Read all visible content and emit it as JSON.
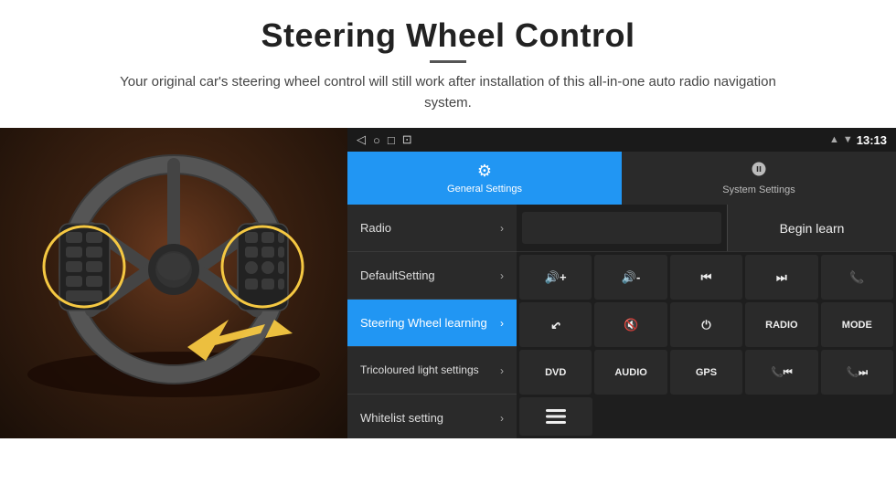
{
  "header": {
    "title": "Steering Wheel Control",
    "divider": true,
    "subtitle": "Your original car's steering wheel control will still work after installation of this all-in-one auto radio navigation system."
  },
  "statusBar": {
    "navBack": "◁",
    "navHome": "○",
    "navRecent": "□",
    "navCast": "⊡",
    "signal": "▾▴",
    "wifi": "▾",
    "time": "13:13"
  },
  "tabs": [
    {
      "id": "general",
      "label": "General Settings",
      "icon": "⚙",
      "active": true
    },
    {
      "id": "system",
      "label": "System Settings",
      "icon": "⚙",
      "active": false
    }
  ],
  "menu": [
    {
      "id": "radio",
      "label": "Radio",
      "active": false
    },
    {
      "id": "default",
      "label": "DefaultSetting",
      "active": false
    },
    {
      "id": "steering",
      "label": "Steering Wheel learning",
      "active": true
    },
    {
      "id": "tricoloured",
      "label": "Tricoloured light settings",
      "active": false
    },
    {
      "id": "whitelist",
      "label": "Whitelist setting",
      "active": false
    }
  ],
  "controls": {
    "beginLearnLabel": "Begin learn",
    "buttons": [
      {
        "id": "vol-up",
        "label": "◀+",
        "symbol": "🔊+"
      },
      {
        "id": "vol-down",
        "label": "◀-",
        "symbol": "🔊-"
      },
      {
        "id": "prev-track",
        "label": "⏮",
        "symbol": "⏮"
      },
      {
        "id": "next-track",
        "label": "⏭",
        "symbol": "⏭"
      },
      {
        "id": "phone",
        "label": "📞",
        "symbol": "📞"
      },
      {
        "id": "hang-up",
        "label": "↩",
        "symbol": "↩"
      },
      {
        "id": "mute",
        "label": "◀×",
        "symbol": "🔇"
      },
      {
        "id": "power",
        "label": "⏻",
        "symbol": "⏻"
      },
      {
        "id": "radio-btn",
        "label": "RADIO",
        "symbol": "RADIO"
      },
      {
        "id": "mode-btn",
        "label": "MODE",
        "symbol": "MODE"
      },
      {
        "id": "dvd-btn",
        "label": "DVD",
        "symbol": "DVD"
      },
      {
        "id": "audio-btn",
        "label": "AUDIO",
        "symbol": "AUDIO"
      },
      {
        "id": "gps-btn",
        "label": "GPS",
        "symbol": "GPS"
      },
      {
        "id": "call-prev",
        "label": "📞⏮",
        "symbol": "📞⏮"
      },
      {
        "id": "call-next",
        "label": "📞⏭",
        "symbol": "📞⏭"
      }
    ],
    "lastRow": [
      {
        "id": "menu-icon",
        "label": "≡",
        "symbol": "≡"
      }
    ]
  }
}
